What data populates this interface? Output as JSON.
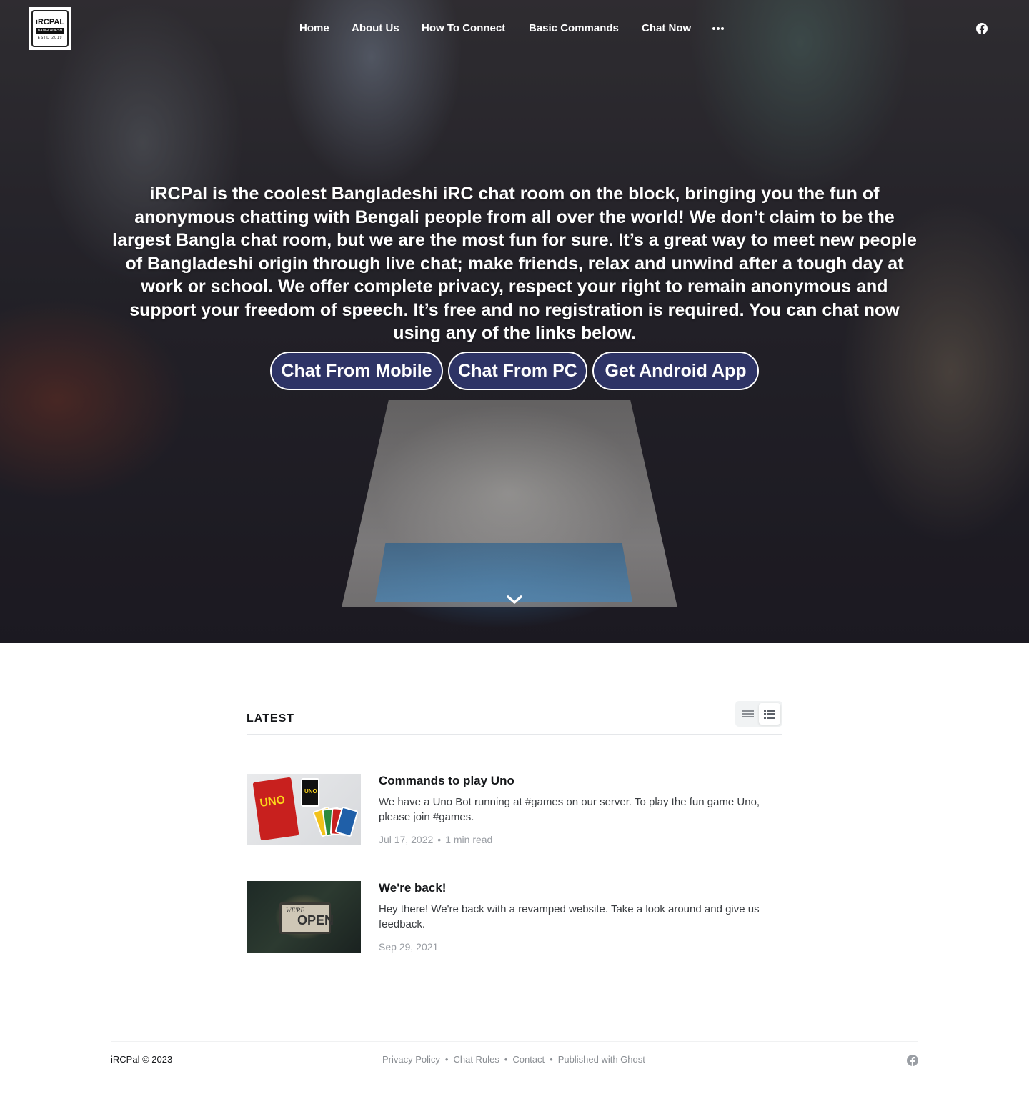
{
  "header": {
    "logo": {
      "line1": "iRCPAL",
      "line2": "BANGLADESH",
      "line3": "ESTD 2019"
    },
    "nav": [
      {
        "label": "Home"
      },
      {
        "label": "About Us"
      },
      {
        "label": "How To Connect"
      },
      {
        "label": "Basic Commands"
      },
      {
        "label": "Chat Now"
      }
    ],
    "more_icon": "more-dots-icon",
    "social_icon": "facebook-icon"
  },
  "hero": {
    "text": "iRCPal is the coolest Bangladeshi iRC chat room on the block, bringing you the fun of anonymous chatting with Bengali people from all over the world! We don’t claim to be the largest Bangla chat room, but we are the most fun for sure. It’s a great way to meet new people of Bangladeshi origin through live chat; make friends, relax and unwind after a tough day at work or school. We offer complete privacy, respect your right to remain anonymous and support your freedom of speech. It’s free and no registration is required. You can chat now using any of the links below.",
    "buttons": [
      {
        "label": "Chat From Mobile"
      },
      {
        "label": "Chat From PC"
      },
      {
        "label": "Get Android App"
      }
    ],
    "button_color": "#2e3466",
    "scroll_icon": "chevron-down-icon"
  },
  "latest": {
    "title": "LATEST",
    "view_icons": [
      "list-view-icon",
      "grid-list-view-icon"
    ],
    "posts": [
      {
        "title": "Commands to play Uno",
        "excerpt": "We have a Uno Bot running at #games on our server. To play the fun game Uno, please join #games.",
        "date": "Jul 17, 2022",
        "reading_time": "1 min read",
        "thumb_text": "UNO"
      },
      {
        "title": "We're back!",
        "excerpt": "Hey there! We're back with a revamped website. Take a look around and give us feedback.",
        "date": "Sep 29, 2021",
        "thumb_text_top": "WE'RE",
        "thumb_text": "OPEN"
      }
    ]
  },
  "footer": {
    "copyright": "iRCPal © 2023",
    "links": [
      {
        "label": "Privacy Policy"
      },
      {
        "label": "Chat Rules"
      },
      {
        "label": "Contact"
      },
      {
        "label": "Published with Ghost"
      }
    ],
    "separator": "•",
    "social_icon": "facebook-icon"
  }
}
